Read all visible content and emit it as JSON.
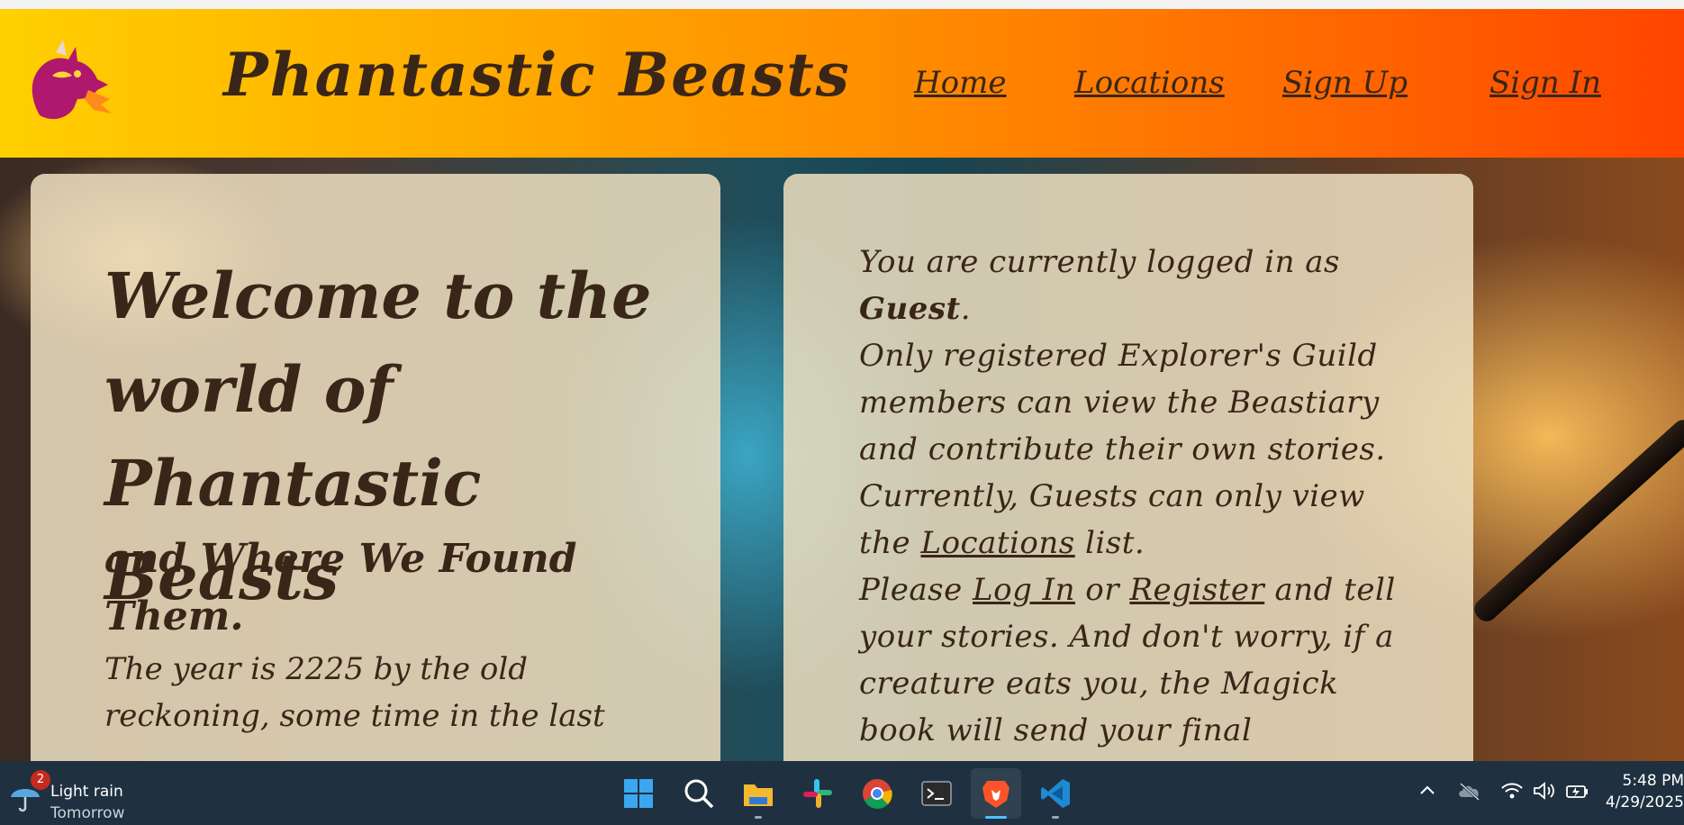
{
  "site": {
    "title": "Phantastic Beasts",
    "nav": [
      {
        "label": "Home"
      },
      {
        "label": "Locations"
      },
      {
        "label": "Sign Up"
      },
      {
        "label": "Sign In"
      }
    ]
  },
  "welcome": {
    "heading": "Welcome to the world of Phantastic Beasts",
    "subheading": "and Where We Found Them.",
    "intro": "The year is 2225 by the old reckoning, some time in the last"
  },
  "info": {
    "logged_in_prefix": "You are currently logged in as",
    "user": "Guest",
    "user_suffix": ".",
    "members_line": "Only registered Explorer's Guild members can view the Beastiary and contribute their own stories.",
    "guests_prefix": "Currently, Guests can only view the",
    "locations_link": "Locations",
    "guests_suffix": "list.",
    "please": "Please",
    "login_link": "Log In",
    "or": "or",
    "register_link": "Register",
    "closing": "and tell your stories. And don't worry, if a creature eats you, the Magick book will send your final"
  },
  "taskbar": {
    "weather": {
      "badge": "2",
      "condition": "Light rain",
      "when": "Tomorrow"
    },
    "apps": [
      "start-icon",
      "search-icon",
      "file-explorer-icon",
      "slack-icon",
      "chrome-icon",
      "terminal-icon",
      "brave-icon",
      "vscode-icon"
    ],
    "clock": {
      "time": "5:48 PM",
      "date": "4/29/2025"
    }
  },
  "colors": {
    "header_start": "#ffd000",
    "header_end": "#ff4500",
    "text_brown": "#3a2618",
    "card_bg": "#ede0c0",
    "taskbar_bg": "#1f3140"
  }
}
